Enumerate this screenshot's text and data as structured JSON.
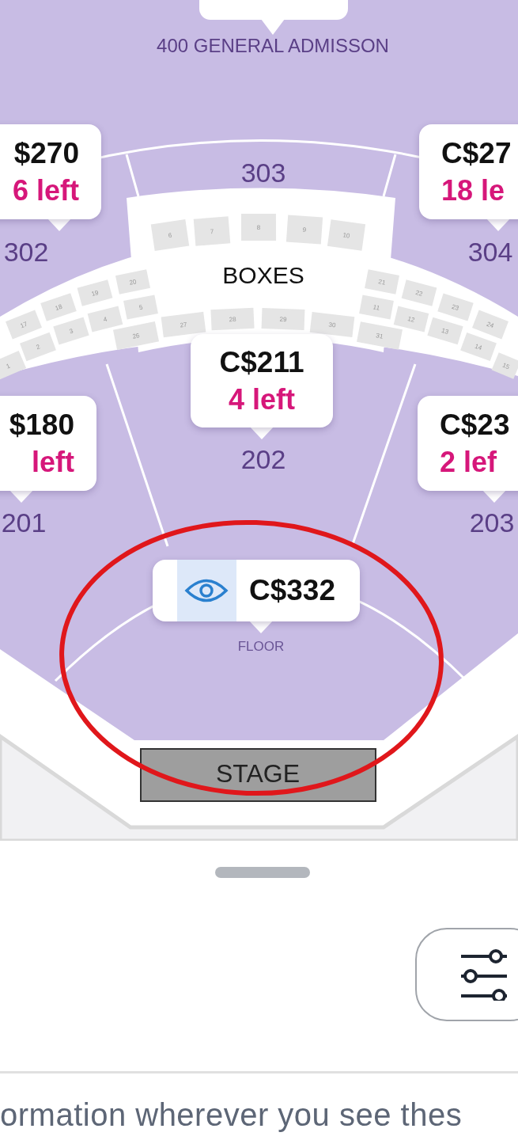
{
  "map": {
    "general_admission": "400 GENERAL ADMISSON",
    "sections": [
      {
        "label": "303"
      },
      {
        "label": "302"
      },
      {
        "label": "304"
      },
      {
        "label": "202"
      },
      {
        "label": "201"
      },
      {
        "label": "203"
      }
    ],
    "boxes_label": "BOXES",
    "boxes": [
      "6",
      "7",
      "8",
      "9",
      "10",
      "20",
      "19",
      "18",
      "17",
      "5",
      "4",
      "3",
      "2",
      "1",
      "26",
      "27",
      "28",
      "29",
      "30",
      "31",
      "21",
      "22",
      "23",
      "24",
      "11",
      "12",
      "13",
      "14",
      "15"
    ],
    "price_tags": [
      {
        "kind": "availability",
        "price": "$270",
        "availability": "6 left"
      },
      {
        "kind": "availability",
        "price": "C$27",
        "availability": "18 le"
      },
      {
        "kind": "availability",
        "price": "C$211",
        "availability": "4 left"
      },
      {
        "kind": "availability",
        "price": "$180",
        "availability": "left"
      },
      {
        "kind": "availability",
        "price": "C$23",
        "availability": "2 lef"
      },
      {
        "kind": "view",
        "price": "C$332"
      }
    ],
    "floor_label": "FLOOR",
    "stage_label": "STAGE"
  },
  "sheet": {
    "text": "ormation wherever you see thes"
  }
}
